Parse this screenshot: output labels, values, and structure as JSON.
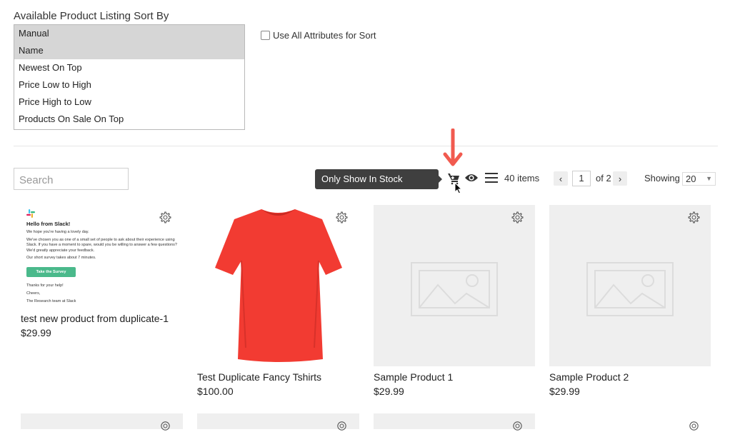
{
  "sort": {
    "title": "Available Product Listing Sort By",
    "options": [
      {
        "label": "Manual",
        "selected": true
      },
      {
        "label": "Name",
        "selected": true
      },
      {
        "label": "Newest On Top",
        "selected": false
      },
      {
        "label": "Price Low to High",
        "selected": false
      },
      {
        "label": "Price High to Low",
        "selected": false
      },
      {
        "label": "Products On Sale On Top",
        "selected": false
      }
    ],
    "use_all_attributes_label": "Use All Attributes for Sort",
    "use_all_attributes_checked": false
  },
  "toolbar": {
    "search_placeholder": "Search",
    "tooltip": "Only Show In Stock Products",
    "item_count": "40 items",
    "page": "1",
    "of_pages": "of 2",
    "showing_label": "Showing",
    "per_page": "20"
  },
  "products": [
    {
      "name": "test new product from duplicate-1",
      "price": "$29.99",
      "image": "slack-email"
    },
    {
      "name": "Test Duplicate Fancy Tshirts",
      "price": "$100.00",
      "image": "red-tshirt"
    },
    {
      "name": "Sample Product 1",
      "price": "$29.99",
      "image": "placeholder"
    },
    {
      "name": "Sample Product 2",
      "price": "$29.99",
      "image": "placeholder"
    }
  ],
  "email_preview": {
    "heading": "Hello from Slack!",
    "line1": "We hope you're having a lovely day.",
    "line2": "We've chosen you as one of a small set of people to ask about their experience using Slack. If you have a moment to spare, would you be willing to answer a few questions? We'd greatly appreciate your feedback.",
    "line3": "Our short survey takes about 7 minutes.",
    "button": "Take the Survey",
    "thanks": "Thanks for your help!",
    "cheers": "Cheers,",
    "sign": "The Research team at Slack"
  },
  "colors": {
    "annotation_arrow": "#f15a4f",
    "survey_button": "#4ab98b",
    "tshirt": "#f23b32",
    "placeholder_bg": "#efefef"
  }
}
